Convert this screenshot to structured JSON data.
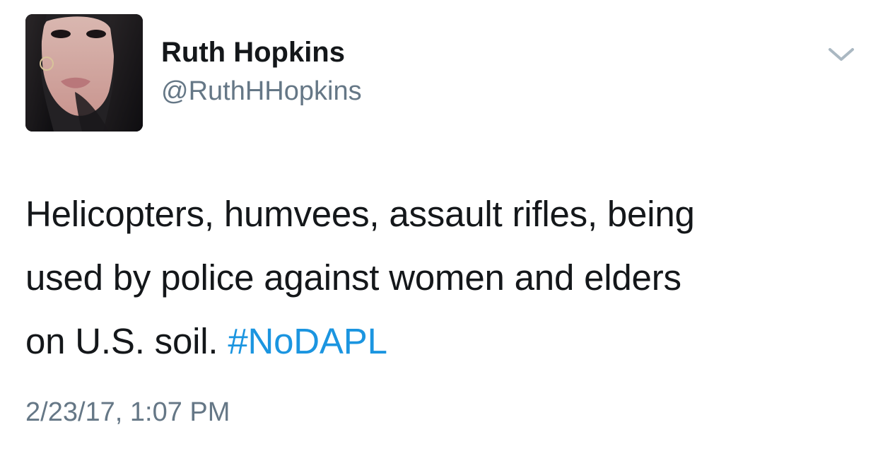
{
  "user": {
    "display_name": "Ruth Hopkins",
    "handle": "@RuthHHopkins",
    "avatar_icon": "profile-photo"
  },
  "menu": {
    "icon": "chevron-down-icon"
  },
  "tweet": {
    "lines": [
      "Helicopters, humvees, assault rifles, being",
      "used by police against women and elders",
      "on U.S. soil."
    ],
    "hashtag": "#NoDAPL",
    "timestamp": "2/23/17, 1:07 PM"
  },
  "colors": {
    "text": "#14171a",
    "secondary": "#657786",
    "link": "#1b95e0",
    "chevron": "#aab8c2"
  }
}
